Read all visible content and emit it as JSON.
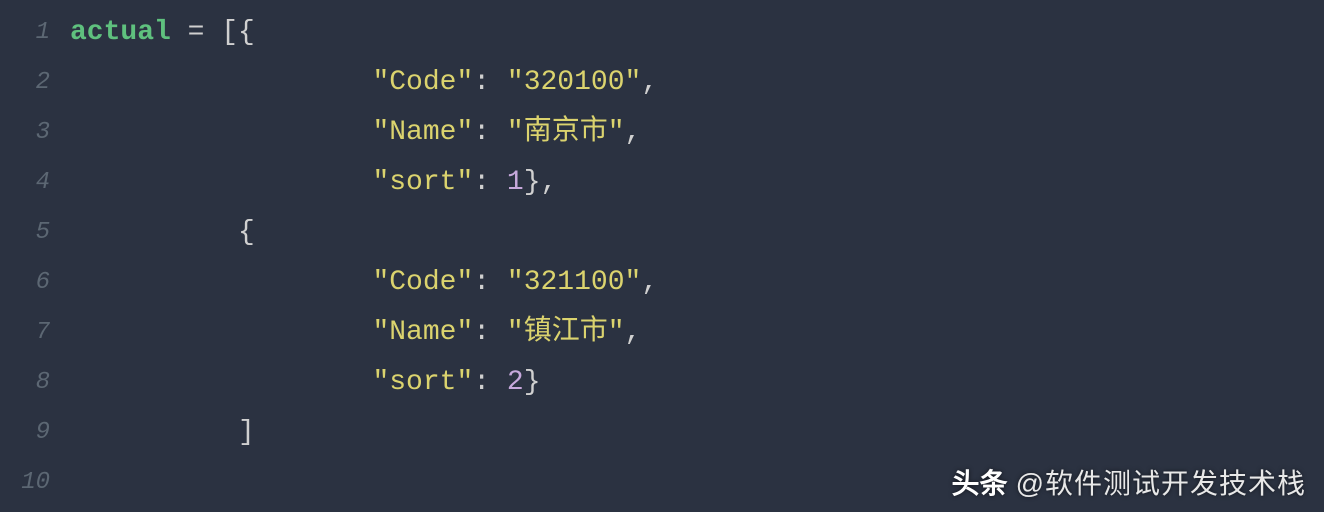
{
  "lineNumbers": [
    "1",
    "2",
    "3",
    "4",
    "5",
    "6",
    "7",
    "8",
    "9",
    "10"
  ],
  "code": {
    "variable": "actual",
    "assign": " = ",
    "openBracket": "[{",
    "line2_key": "\"Code\"",
    "line2_sep": ": ",
    "line2_val": "\"320100\"",
    "line2_end": ",",
    "line3_key": "\"Name\"",
    "line3_sep": ": ",
    "line3_val": "\"南京市\"",
    "line3_end": ",",
    "line4_key": "\"sort\"",
    "line4_sep": ": ",
    "line4_val": "1",
    "line4_end": "},",
    "line5_open": "{",
    "line6_key": "\"Code\"",
    "line6_sep": ": ",
    "line6_val": "\"321100\"",
    "line6_end": ",",
    "line7_key": "\"Name\"",
    "line7_sep": ": ",
    "line7_val": "\"镇江市\"",
    "line7_end": ",",
    "line8_key": "\"sort\"",
    "line8_sep": ": ",
    "line8_val": "2",
    "line8_end": "}",
    "line9_close": "]"
  },
  "indent": {
    "level1": "          ",
    "level2": "                  "
  },
  "watermark": {
    "label": "头条",
    "handle": "@软件测试开发技术栈"
  }
}
